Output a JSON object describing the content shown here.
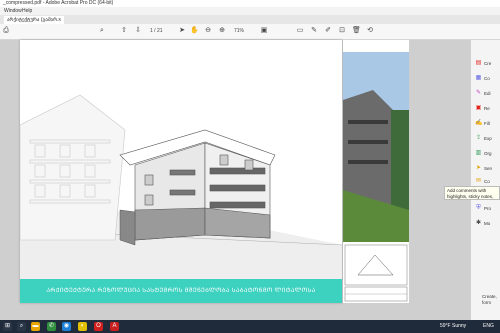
{
  "window": {
    "title": "_compressed.pdf - Adobe Acrobat Pro DC (64-bit)"
  },
  "menu": {
    "items": [
      "Window",
      "Help"
    ]
  },
  "tabs": [
    {
      "label": "არქიტექტურა (გამარ...",
      "close": "×"
    }
  ],
  "toolbar": {
    "page_indicator": "1 / 21",
    "zoom": "71%"
  },
  "banner": {
    "text": "ᲐᲠᲥᲘᲢᲔᲥᲢᲣᲠᲐ ᲠᲔᲖᲝᲚᲣᲪᲘᲐ ᲡᲐᲡᲢᲣᲛᲠᲝᲡ ᲛᲨᲔᲜᲔᲑᲚᲝᲑᲐ ᲡᲐᲑᲐᲢᲝᲜᲛᲝ ᲚᲘᲢᲐᲚᲝᲡᲐ"
  },
  "right_panel": {
    "items": [
      {
        "label": "Cre",
        "icon": "create-icon"
      },
      {
        "label": "Co",
        "icon": "combine-icon"
      },
      {
        "label": "Edi",
        "icon": "edit-icon"
      },
      {
        "label": "Re",
        "icon": "request-icon"
      },
      {
        "label": "Fill",
        "icon": "fill-sign-icon"
      },
      {
        "label": "Exp",
        "icon": "export-icon"
      },
      {
        "label": "Org",
        "icon": "organize-icon"
      },
      {
        "label": "Sen",
        "icon": "send-icon"
      },
      {
        "label": "Co",
        "icon": "comment-icon"
      },
      {
        "label": "Pro",
        "icon": "protect-icon"
      },
      {
        "label": "Mo",
        "icon": "more-tools-icon"
      }
    ],
    "tooltip": "Add comments with highlights, sticky notes, ... tools",
    "bottom_text": [
      "Create,",
      "form"
    ]
  },
  "taskbar": {
    "weather": "59°F Sunny",
    "time": "",
    "lang": "ENG"
  },
  "colors": {
    "banner": "#3dd1c0",
    "accent": "#e1251b"
  }
}
